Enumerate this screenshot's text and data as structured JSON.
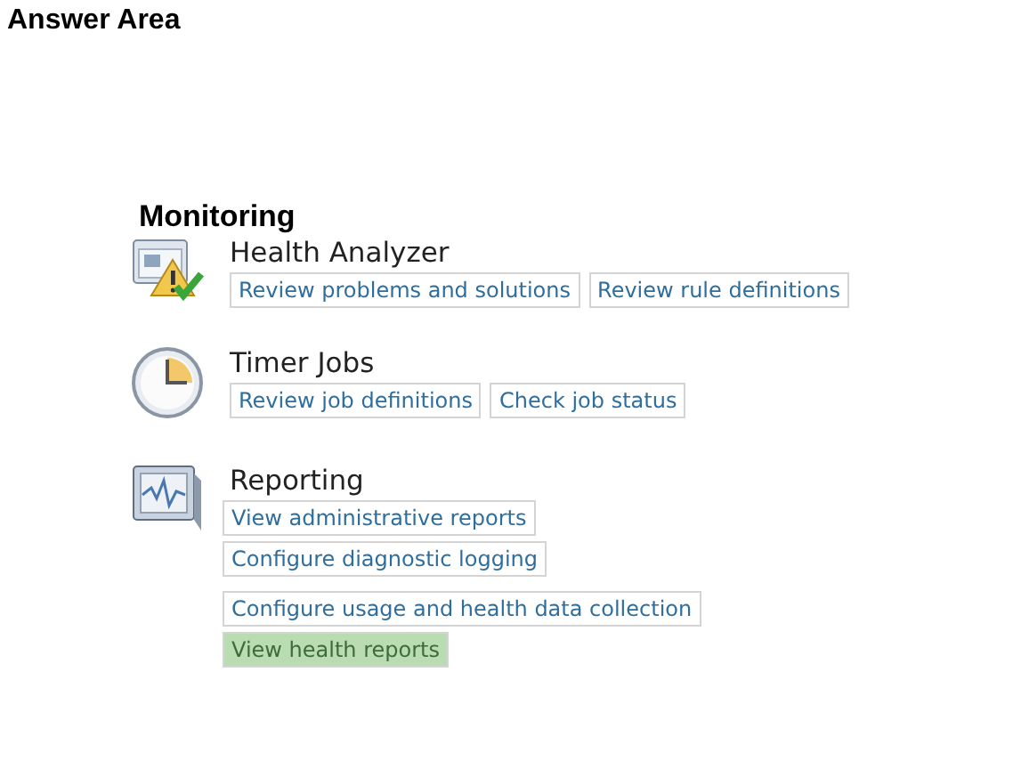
{
  "title": "Answer Area",
  "heading": "Monitoring",
  "sections": [
    {
      "kind": "health",
      "title": "Health Analyzer",
      "links": [
        {
          "label": "Review problems and solutions",
          "selected": false
        },
        {
          "label": "Review rule definitions",
          "selected": false
        }
      ]
    },
    {
      "kind": "timer",
      "title": "Timer Jobs",
      "links": [
        {
          "label": "Review job definitions",
          "selected": false
        },
        {
          "label": "Check job status",
          "selected": false
        }
      ]
    },
    {
      "kind": "reporting",
      "title": "Reporting",
      "links": [
        {
          "label": "View administrative reports",
          "selected": false
        },
        {
          "label": "Configure diagnostic logging",
          "selected": false
        },
        {
          "label": "Configure usage and health data collection",
          "selected": false
        },
        {
          "label": "View health reports",
          "selected": true
        }
      ]
    }
  ]
}
